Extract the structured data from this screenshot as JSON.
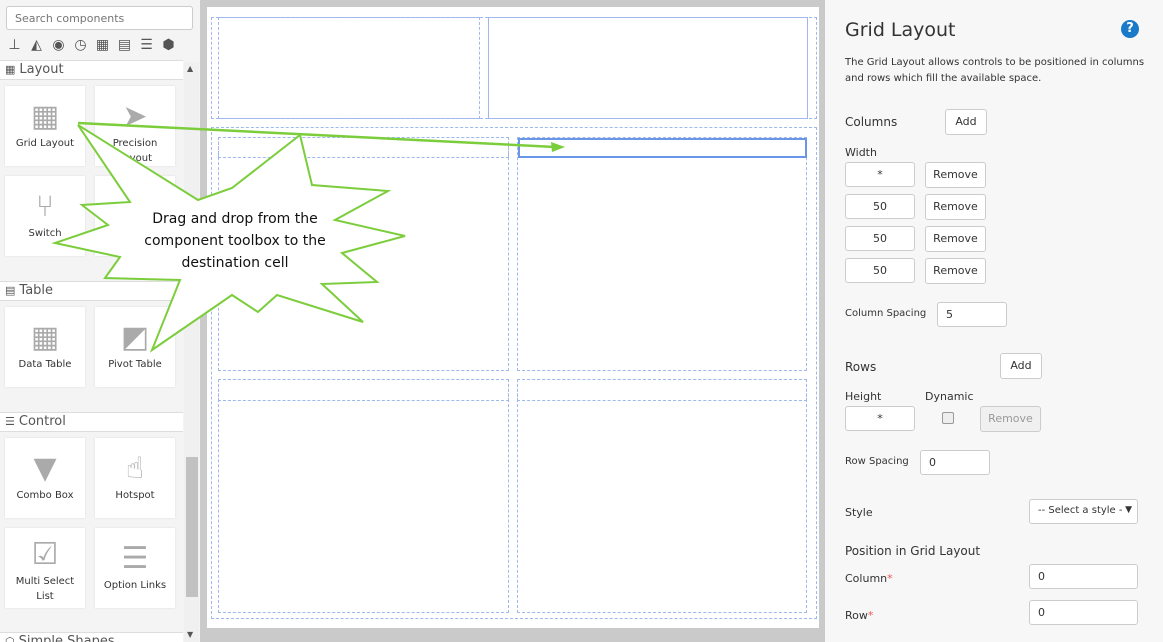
{
  "toolbox": {
    "search_placeholder": "Search components",
    "filter_icons": [
      "hierarchy-icon",
      "area-chart-icon",
      "eye-icon",
      "clock-icon",
      "grid-icon",
      "table-icon",
      "sliders-icon",
      "cube-icon"
    ],
    "sections": [
      {
        "label": "Layout",
        "items": [
          {
            "label": "Grid Layout"
          },
          {
            "label": "Precision Layout"
          },
          {
            "label": "Switch"
          }
        ]
      },
      {
        "label": "Table",
        "items": [
          {
            "label": "Data Table"
          },
          {
            "label": "Pivot Table"
          }
        ]
      },
      {
        "label": "Control",
        "items": [
          {
            "label": "Combo Box"
          },
          {
            "label": "Hotspot"
          },
          {
            "label": "Multi Select List"
          },
          {
            "label": "Option Links"
          }
        ]
      },
      {
        "label": "Simple Shapes"
      }
    ]
  },
  "callout": {
    "text": "Drag and drop from the component toolbox to the destination cell"
  },
  "panel": {
    "title": "Grid Layout",
    "description": "The Grid Layout allows controls to be positioned in columns and rows which fill the available space.",
    "columns_label": "Columns",
    "add_label": "Add",
    "width_label": "Width",
    "columns": [
      {
        "width": "*"
      },
      {
        "width": "50"
      },
      {
        "width": "50"
      },
      {
        "width": "50"
      }
    ],
    "remove_label": "Remove",
    "column_spacing_label": "Column Spacing",
    "column_spacing": "5",
    "rows_label": "Rows",
    "height_label": "Height",
    "dynamic_label": "Dynamic",
    "rows": [
      {
        "height": "*",
        "dynamic": false
      }
    ],
    "row_spacing_label": "Row Spacing",
    "row_spacing": "0",
    "style_label": "Style",
    "style_value": "-- Select a style -",
    "position_title": "Position in Grid Layout",
    "column_label": "Column",
    "column_value": "0",
    "row_label": "Row",
    "row_value": "0",
    "required_mark": "*"
  }
}
